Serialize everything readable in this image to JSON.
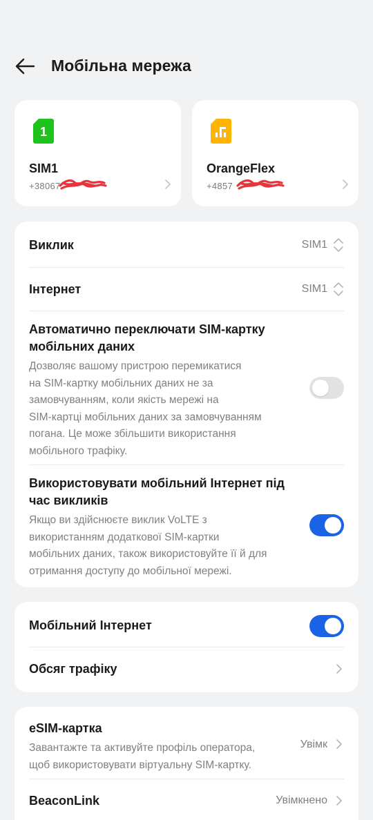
{
  "header": {
    "title": "Мобільна мережа"
  },
  "sims": [
    {
      "name": "SIM1",
      "number": "+38067",
      "icon_color": "#1ec31e",
      "icon_glyph": "1"
    },
    {
      "name": "OrangeFlex",
      "number": "+4857",
      "icon_color": "#ffb400"
    }
  ],
  "sim_settings": {
    "call": {
      "label": "Виклик",
      "value": "SIM1"
    },
    "internet": {
      "label": "Інтернет",
      "value": "SIM1"
    },
    "auto_switch": {
      "title_line1": "Автоматично переключати SIM-картку",
      "title_line2": "мобільних даних",
      "desc_lines": [
        "Дозволяє вашому пристрою перемикатися",
        "на SIM-картку мобільних даних не за",
        "замовчуванням, коли якість мережі на",
        "SIM-картці мобільних даних за замовчуванням",
        "погана. Це може збільшити використання",
        "мобільного трафіку."
      ],
      "enabled": false
    },
    "data_during_calls": {
      "title_line1": "Використовувати мобільний Інтернет під",
      "title_line2": "час викликів",
      "desc_lines": [
        "Якщо ви здійснюєте виклик VoLTE з",
        "використанням додаткової SIM-картки",
        "мобільних даних, також використовуйте її й для",
        "отримання доступу до мобільної мережі."
      ],
      "enabled": true
    }
  },
  "data_section": {
    "mobile_internet": {
      "label": "Мобільний Інтернет",
      "enabled": true
    },
    "traffic": {
      "label": "Обсяг трафіку"
    }
  },
  "esim_section": {
    "esim": {
      "label": "eSIM-картка",
      "desc_lines": [
        "Завантажте та активуйте профіль оператора,",
        "щоб використовувати віртуальну SIM-картку."
      ],
      "value": "Увімк"
    },
    "beaconlink": {
      "label": "BeaconLink",
      "value": "Увімкнено"
    }
  },
  "colors": {
    "accent": "#1a63e6",
    "background": "#f1f2f4",
    "redaction": "#e8343a"
  }
}
